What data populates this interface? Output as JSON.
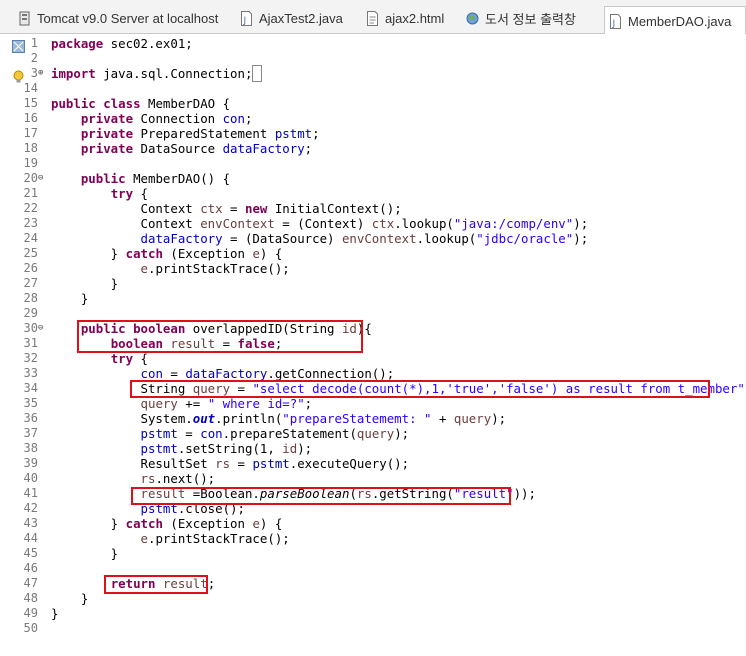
{
  "tabs": [
    {
      "label": "Tomcat v9.0 Server at localhost",
      "icon": "server-icon",
      "active": false
    },
    {
      "label": "AjaxTest2.java",
      "icon": "java-file-icon",
      "active": false
    },
    {
      "label": "ajax2.html",
      "icon": "html-file-icon",
      "active": false
    },
    {
      "label": "도서 정보 출력창",
      "icon": "globe-icon",
      "active": false
    },
    {
      "label": "MemberDAO.java",
      "icon": "java-file-icon",
      "active": true
    }
  ],
  "editor": {
    "lines": [
      {
        "n": "1",
        "html": "<span class=\"kw\">package</span> sec02.ex01;"
      },
      {
        "n": "2",
        "html": ""
      },
      {
        "n": "3",
        "html": "<span class=\"kw\">import</span> java.sql.Connection;<span style=\"border:1px solid #888\">&nbsp;</span>"
      },
      {
        "n": "14",
        "html": ""
      },
      {
        "n": "15",
        "html": "<span class=\"kw\">public</span> <span class=\"kw\">class</span> MemberDAO {"
      },
      {
        "n": "16",
        "html": "    <span class=\"kw\">private</span> Connection <span class=\"fld\">con</span>;"
      },
      {
        "n": "17",
        "html": "    <span class=\"kw\">private</span> PreparedStatement <span class=\"fld\">pstmt</span>;"
      },
      {
        "n": "18",
        "html": "    <span class=\"kw\">private</span> DataSource <span class=\"fld\">dataFactory</span>;"
      },
      {
        "n": "19",
        "html": ""
      },
      {
        "n": "20",
        "html": "    <span class=\"kw\">public</span> MemberDAO() {"
      },
      {
        "n": "21",
        "html": "        <span class=\"kw\">try</span> {"
      },
      {
        "n": "22",
        "html": "            Context <span class=\"var\">ctx</span> = <span class=\"kw\">new</span> InitialContext();"
      },
      {
        "n": "23",
        "html": "            Context <span class=\"var\">envContext</span> = (Context) <span class=\"var\">ctx</span>.lookup(<span class=\"str\">\"java:/comp/env\"</span>);"
      },
      {
        "n": "24",
        "html": "            <span class=\"fld\">dataFactory</span> = (DataSource) <span class=\"var\">envContext</span>.lookup(<span class=\"str\">\"jdbc/oracle\"</span>);"
      },
      {
        "n": "25",
        "html": "        } <span class=\"kw\">catch</span> (Exception <span class=\"var\">e</span>) {"
      },
      {
        "n": "26",
        "html": "            <span class=\"var\">e</span>.printStackTrace();"
      },
      {
        "n": "27",
        "html": "        }"
      },
      {
        "n": "28",
        "html": "    }"
      },
      {
        "n": "29",
        "html": ""
      },
      {
        "n": "30",
        "html": "    <span class=\"kw\">public</span> <span class=\"kw\">boolean</span> overlappedID(String <span class=\"var\">id</span>){"
      },
      {
        "n": "31",
        "html": "        <span class=\"kw\">boolean</span> <span class=\"var\">result</span> = <span class=\"kw\">false</span>;"
      },
      {
        "n": "32",
        "html": "        <span class=\"kw\">try</span> {"
      },
      {
        "n": "33",
        "html": "            <span class=\"fld\">con</span> = <span class=\"fld\">dataFactory</span>.getConnection();"
      },
      {
        "n": "34",
        "html": "            String <span class=\"var\">query</span> = <span class=\"str\">\"select decode(count(*),1,'true','false') as result from t_member\"</span>;"
      },
      {
        "n": "35",
        "html": "            <span class=\"var\">query</span> += <span class=\"str\">\" where id=?\"</span>;"
      },
      {
        "n": "36",
        "html": "            System.<span class=\"fld it\" style=\"font-weight:bold\">out</span>.println(<span class=\"str\">\"prepareStatememt: \"</span> + <span class=\"var\">query</span>);"
      },
      {
        "n": "37",
        "html": "            <span class=\"fld\">pstmt</span> = <span class=\"fld\">con</span>.prepareStatement(<span class=\"var\">query</span>);"
      },
      {
        "n": "38",
        "html": "            <span class=\"fld\">pstmt</span>.setString(1, <span class=\"var\">id</span>);"
      },
      {
        "n": "39",
        "html": "            ResultSet <span class=\"var\">rs</span> = <span class=\"fld\">pstmt</span>.executeQuery();"
      },
      {
        "n": "40",
        "html": "            <span class=\"var\">rs</span>.next();"
      },
      {
        "n": "41",
        "html": "            <span class=\"var\">result</span> =Boolean.<span class=\"it\">parseBoolean</span>(<span class=\"var\">rs</span>.getString(<span class=\"str\">\"result\"</span>));"
      },
      {
        "n": "42",
        "html": "            <span class=\"fld\">pstmt</span>.close();"
      },
      {
        "n": "43",
        "html": "        } <span class=\"kw\">catch</span> (Exception <span class=\"var\">e</span>) {"
      },
      {
        "n": "44",
        "html": "            <span class=\"var\">e</span>.printStackTrace();"
      },
      {
        "n": "45",
        "html": "        }"
      },
      {
        "n": "46",
        "html": ""
      },
      {
        "n": "47",
        "html": "        <span class=\"kw\">return</span> <span class=\"var\">result</span>;"
      },
      {
        "n": "48",
        "html": "    }"
      },
      {
        "n": "49",
        "html": "}"
      },
      {
        "n": "50",
        "html": ""
      }
    ]
  },
  "colors": {
    "keyword": "#7f0055",
    "string": "#2a00ff",
    "field": "#0000c0",
    "local_variable": "#6a3e3e",
    "highlight_box": "#e0101a"
  }
}
